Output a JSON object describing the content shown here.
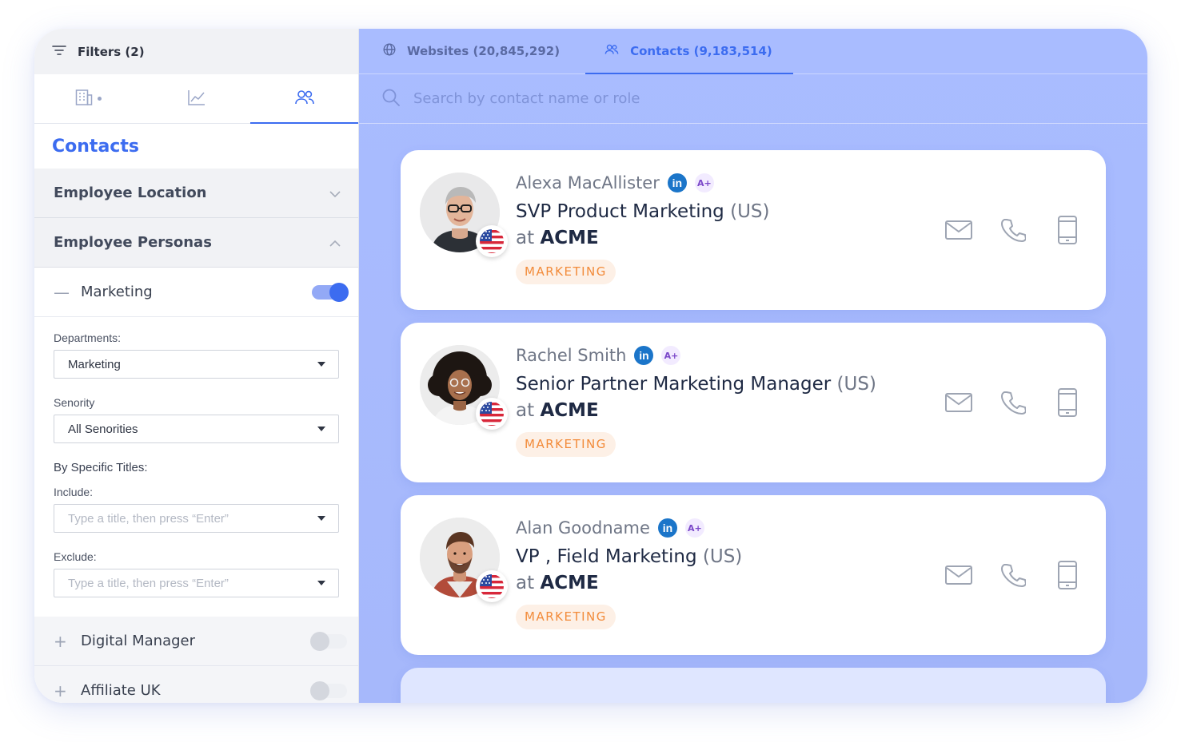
{
  "sidebar": {
    "filters_label": "Filters (2)",
    "section_heading": "Contacts",
    "accordions": [
      {
        "title": "Employee Location",
        "expanded": false
      },
      {
        "title": "Employee Personas",
        "expanded": true
      }
    ],
    "personas": [
      {
        "name": "Marketing",
        "sign": "—",
        "enabled": true
      },
      {
        "name": "Digital Manager",
        "sign": "+",
        "enabled": false
      },
      {
        "name": "Affiliate UK",
        "sign": "+",
        "enabled": false
      }
    ],
    "form": {
      "departments_label": "Departments:",
      "departments_value": "Marketing",
      "seniority_label": "Senority",
      "seniority_value": "All Senorities",
      "specific_titles_label": "By Specific Titles:",
      "include_label": "Include:",
      "include_placeholder": "Type a title, then press “Enter”",
      "exclude_label": "Exclude:",
      "exclude_placeholder": "Type a title, then press “Enter”"
    }
  },
  "main": {
    "tabs": [
      {
        "label": "Websites (20,845,292)",
        "icon": "globe-icon",
        "active": false
      },
      {
        "label": "Contacts (9,183,514)",
        "icon": "users-icon",
        "active": true
      }
    ],
    "search_placeholder": "Search by contact name or role",
    "contacts": [
      {
        "name": "Alexa MacAllister",
        "linkedin": "in",
        "grade": "A+",
        "title": "SVP Product Marketing",
        "region": "(US)",
        "at": "at",
        "company": "ACME",
        "department": "MARKETING"
      },
      {
        "name": "Rachel Smith",
        "linkedin": "in",
        "grade": "A+",
        "title": "Senior Partner Marketing Manager",
        "region": "(US)",
        "at": "at",
        "company": "ACME",
        "department": "MARKETING"
      },
      {
        "name": "Alan Goodname",
        "linkedin": "in",
        "grade": "A+",
        "title": "VP , Field Marketing",
        "region": "(US)",
        "at": "at",
        "company": "ACME",
        "department": "MARKETING"
      }
    ]
  },
  "colors": {
    "accent": "#3c6cf0",
    "main_background": "#a9bcff",
    "badge_text": "#f28b3a",
    "badge_bg": "#fdf0e6",
    "linkedin": "#1b75c9"
  }
}
